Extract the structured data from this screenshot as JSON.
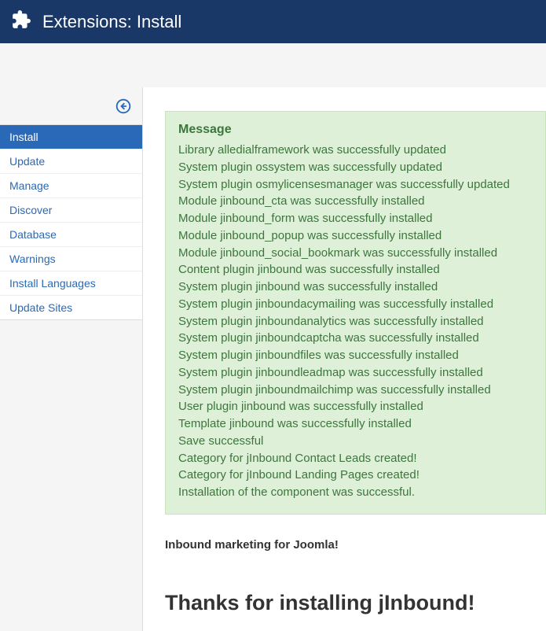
{
  "header": {
    "title": "Extensions: Install"
  },
  "sidebar": {
    "items": [
      {
        "label": "Install",
        "active": true
      },
      {
        "label": "Update",
        "active": false
      },
      {
        "label": "Manage",
        "active": false
      },
      {
        "label": "Discover",
        "active": false
      },
      {
        "label": "Database",
        "active": false
      },
      {
        "label": "Warnings",
        "active": false
      },
      {
        "label": "Install Languages",
        "active": false
      },
      {
        "label": "Update Sites",
        "active": false
      }
    ]
  },
  "message": {
    "title": "Message",
    "lines": [
      "Library alledialframework was successfully updated",
      "System plugin ossystem was successfully updated",
      "System plugin osmylicensesmanager was successfully updated",
      "Module jinbound_cta was successfully installed",
      "Module jinbound_form was successfully installed",
      "Module jinbound_popup was successfully installed",
      "Module jinbound_social_bookmark was successfully installed",
      "Content plugin jinbound was successfully installed",
      "System plugin jinbound was successfully installed",
      "System plugin jinboundacymailing was successfully installed",
      "System plugin jinboundanalytics was successfully installed",
      "System plugin jinboundcaptcha was successfully installed",
      "System plugin jinboundfiles was successfully installed",
      "System plugin jinboundleadmap was successfully installed",
      "System plugin jinboundmailchimp was successfully installed",
      "User plugin jinbound was successfully installed",
      "Template jinbound was successfully installed",
      "Save successful",
      "Category for jInbound Contact Leads created!",
      "Category for jInbound Landing Pages created!",
      "Installation of the component was successful."
    ]
  },
  "main": {
    "subtitle": "Inbound marketing for Joomla!",
    "thanks": "Thanks for installing jInbound!"
  }
}
